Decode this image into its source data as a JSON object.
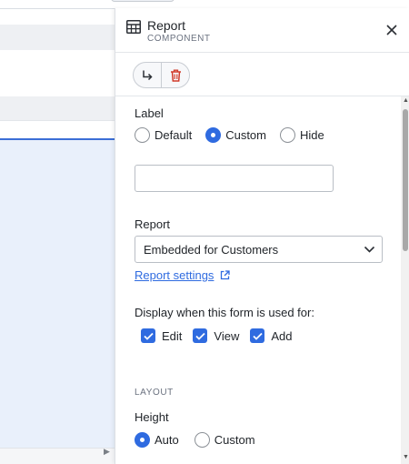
{
  "panel": {
    "title": "Report",
    "subtitle": "COMPONENT",
    "icon": "table-icon",
    "close_icon": "close-icon"
  },
  "toolbar": {
    "redirect_icon": "arrow-turn-down-right-icon",
    "delete_icon": "trash-icon",
    "delete_color": "#d13b2a"
  },
  "label_section": {
    "heading": "Label",
    "options": [
      "Default",
      "Custom",
      "Hide"
    ],
    "selected": "Custom",
    "custom_value": "",
    "placeholder": ""
  },
  "report_section": {
    "heading": "Report",
    "selected": "Embedded for Customers",
    "link_label": "Report settings",
    "link_icon": "external-link-icon"
  },
  "display_section": {
    "heading": "Display when this form is used for:",
    "options": [
      {
        "label": "Edit",
        "checked": true
      },
      {
        "label": "View",
        "checked": true
      },
      {
        "label": "Add",
        "checked": true
      }
    ]
  },
  "layout_section": {
    "heading": "LAYOUT",
    "height_label": "Height",
    "height_options": [
      "Auto",
      "Custom"
    ],
    "height_selected": "Auto"
  },
  "colors": {
    "accent": "#2f6be0",
    "selected_bg": "#e9f0fb"
  }
}
